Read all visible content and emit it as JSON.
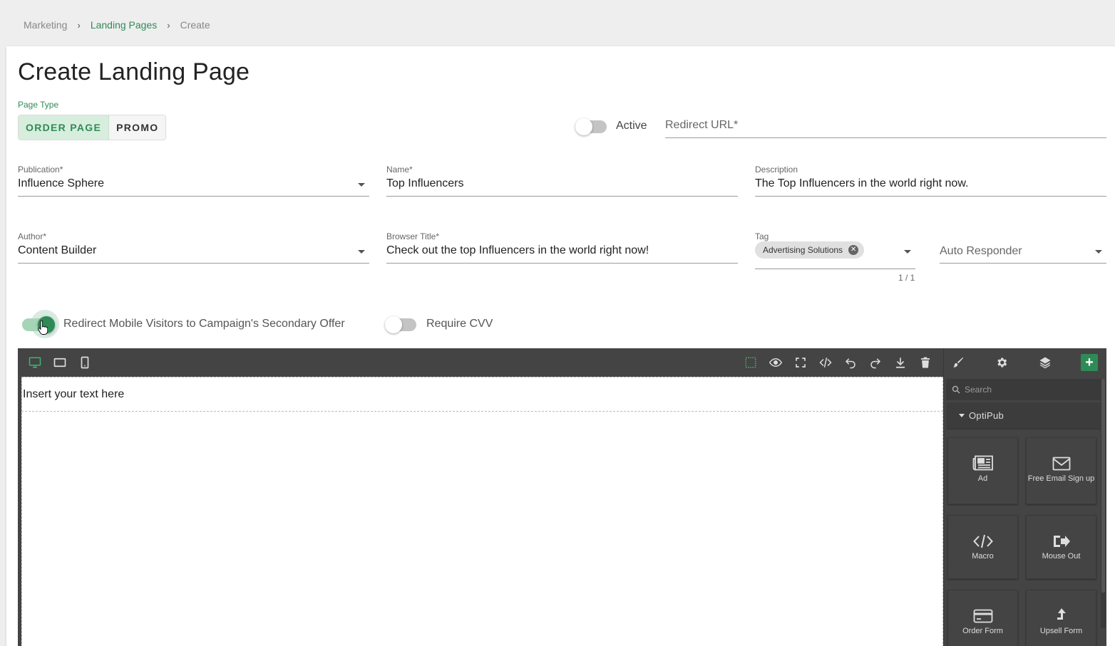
{
  "breadcrumb": {
    "items": [
      "Marketing",
      "Landing Pages",
      "Create"
    ]
  },
  "page": {
    "title": "Create Landing Page"
  },
  "page_type": {
    "label": "Page Type",
    "options": [
      "ORDER PAGE",
      "PROMO"
    ],
    "selected": "ORDER PAGE"
  },
  "active_switch": {
    "label": "Active",
    "on": false
  },
  "redirect_url": {
    "placeholder": "Redirect URL*",
    "value": ""
  },
  "publication": {
    "label": "Publication*",
    "value": "Influence Sphere"
  },
  "name": {
    "label": "Name*",
    "value": "Top Influencers"
  },
  "description": {
    "label": "Description",
    "value": "The Top Influencers in the world right now."
  },
  "author": {
    "label": "Author*",
    "value": "Content Builder"
  },
  "browser_title": {
    "label": "Browser Title*",
    "value": "Check out the top Influencers in the world right now!"
  },
  "tag": {
    "label": "Tag",
    "chips": [
      "Advertising Solutions"
    ],
    "counter": "1 / 1"
  },
  "auto_responder": {
    "placeholder": "Auto Responder"
  },
  "redirect_mobile": {
    "label": "Redirect Mobile Visitors to Campaign's Secondary Offer",
    "on": true
  },
  "require_cvv": {
    "label": "Require CVV",
    "on": false
  },
  "editor": {
    "device_icons": [
      "desktop-icon",
      "tablet-icon",
      "mobile-icon"
    ],
    "toolbar_icons": [
      "outline-icon",
      "preview-icon",
      "fullscreen-icon",
      "code-icon",
      "undo-icon",
      "redo-icon",
      "download-icon",
      "trash-icon"
    ],
    "panel_icons": [
      "brush-icon",
      "gear-icon",
      "layers-icon",
      "plus-icon"
    ],
    "canvas_text": "Insert your text here",
    "search_placeholder": "Search",
    "group_title": "OptiPub",
    "blocks": [
      {
        "label": "Ad",
        "icon": "newspaper-icon"
      },
      {
        "label": "Free Email Sign up",
        "icon": "envelope-icon"
      },
      {
        "label": "Macro",
        "icon": "code-icon"
      },
      {
        "label": "Mouse Out",
        "icon": "exit-icon"
      },
      {
        "label": "Order Form",
        "icon": "credit-card-icon"
      },
      {
        "label": "Upsell Form",
        "icon": "turn-up-icon"
      }
    ],
    "accent_color": "#2e8b57"
  }
}
